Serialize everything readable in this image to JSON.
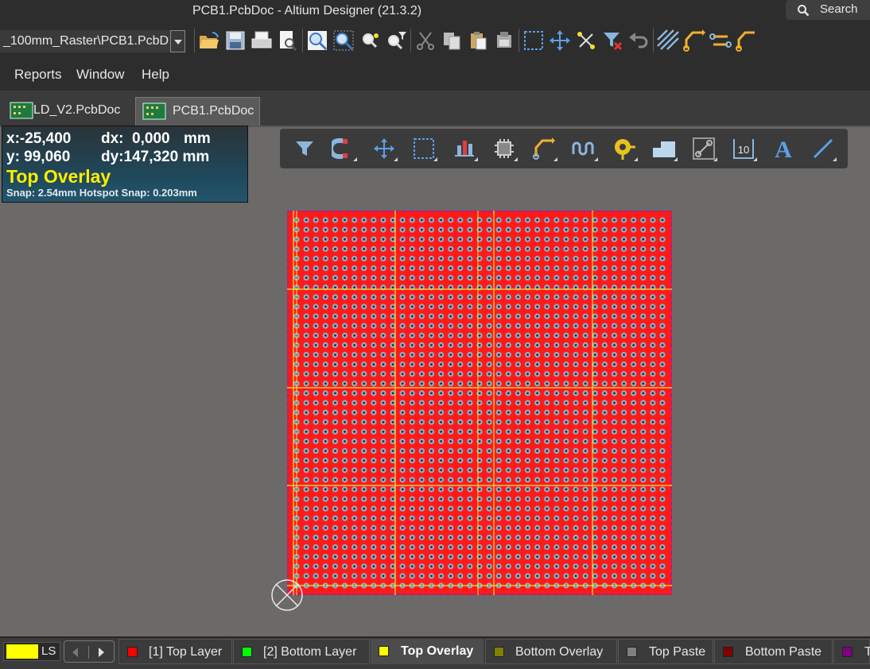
{
  "window": {
    "title": "PCB1.PcbDoc - Altium Designer (21.3.2)",
    "search_label": "Search"
  },
  "toolbar": {
    "document_path": "_100mm_Raster\\PCB1.PcbD"
  },
  "menu": {
    "reports": "Reports",
    "window": "Window",
    "help": "Help"
  },
  "tabs": [
    {
      "label": "LD_V2.PcbDoc",
      "active": false
    },
    {
      "label": "PCB1.PcbDoc",
      "active": true
    }
  ],
  "hud": {
    "x": "x:-25,400",
    "dx": "dx:  0,000",
    "unit": "mm",
    "y": "y: 99,060",
    "dy": "dy:147,320 mm",
    "layer": "Top Overlay",
    "snap": "Snap: 2.54mm Hotspot Snap: 0.203mm"
  },
  "action_bar": {
    "icons": [
      "filter-icon",
      "magnet-icon",
      "move-icon",
      "select-rect-icon",
      "align-icon",
      "component-icon",
      "route-icon",
      "interactive-length-icon",
      "via-icon",
      "region-icon",
      "keepout-icon",
      "dimension-icon",
      "text-icon",
      "line-icon"
    ],
    "dimension_text": "10",
    "text_tool_glyph": "A"
  },
  "board": {
    "fill_color": "#ff1a1a",
    "pad_color": "#8bb0c8",
    "overlay_color": "#e8e840"
  },
  "layers": {
    "current_swatch": "#ffff00",
    "ls_label": "LS",
    "tabs": [
      {
        "label": "[1] Top Layer",
        "color": "#ff0000",
        "active": false
      },
      {
        "label": "[2] Bottom Layer",
        "color": "#00ff00",
        "active": false
      },
      {
        "label": "Top Overlay",
        "color": "#ffff00",
        "active": true
      },
      {
        "label": "Bottom Overlay",
        "color": "#808000",
        "active": false
      },
      {
        "label": "Top Paste",
        "color": "#808080",
        "active": false
      },
      {
        "label": "Bottom Paste",
        "color": "#800000",
        "active": false
      },
      {
        "label": "T",
        "color": "#800080",
        "active": false
      }
    ]
  }
}
